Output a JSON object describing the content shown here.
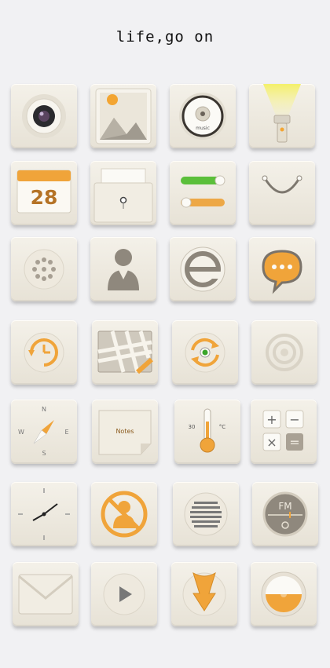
{
  "header": {
    "title": "life,go on"
  },
  "tiles": {
    "camera": {
      "icon": "camera-icon"
    },
    "gallery": {
      "icon": "gallery-icon"
    },
    "music": {
      "icon": "music-disc-icon",
      "label": "music"
    },
    "flashlight": {
      "icon": "flashlight-icon"
    },
    "calendar": {
      "icon": "calendar-icon",
      "day": "28"
    },
    "files": {
      "icon": "folder-icon"
    },
    "settings": {
      "icon": "toggle-settings-icon"
    },
    "shop": {
      "icon": "shopping-bag-icon"
    },
    "phone": {
      "icon": "dial-pad-icon"
    },
    "contacts": {
      "icon": "contact-icon"
    },
    "browser": {
      "icon": "browser-e-icon"
    },
    "messages": {
      "icon": "message-bubble-icon"
    },
    "clock_history": {
      "icon": "clock-refresh-icon"
    },
    "maps": {
      "icon": "map-icon"
    },
    "sync": {
      "icon": "sync-icon"
    },
    "radar": {
      "icon": "ripple-icon"
    },
    "compass": {
      "icon": "compass-icon",
      "n": "N",
      "s": "S",
      "e": "E",
      "w": "W"
    },
    "notes": {
      "icon": "notes-icon",
      "label": "Notes"
    },
    "weather": {
      "icon": "thermometer-icon",
      "value": "30",
      "unit": "°C"
    },
    "calculator": {
      "icon": "calculator-icon",
      "plus": "+",
      "minus": "−",
      "times": "×",
      "equals": "="
    },
    "clock": {
      "icon": "analog-clock-icon"
    },
    "block": {
      "icon": "blocked-contact-icon"
    },
    "speaker": {
      "icon": "speaker-icon"
    },
    "radio": {
      "icon": "fm-radio-icon",
      "label": "FM"
    },
    "mail": {
      "icon": "mail-icon"
    },
    "player": {
      "icon": "play-icon"
    },
    "download": {
      "icon": "download-icon"
    },
    "storage": {
      "icon": "pie-gauge-icon"
    }
  },
  "colors": {
    "accent": "#f1a52e",
    "green": "#5bbf3a",
    "tile": "#ece7dc",
    "icon": "#8c857a"
  }
}
